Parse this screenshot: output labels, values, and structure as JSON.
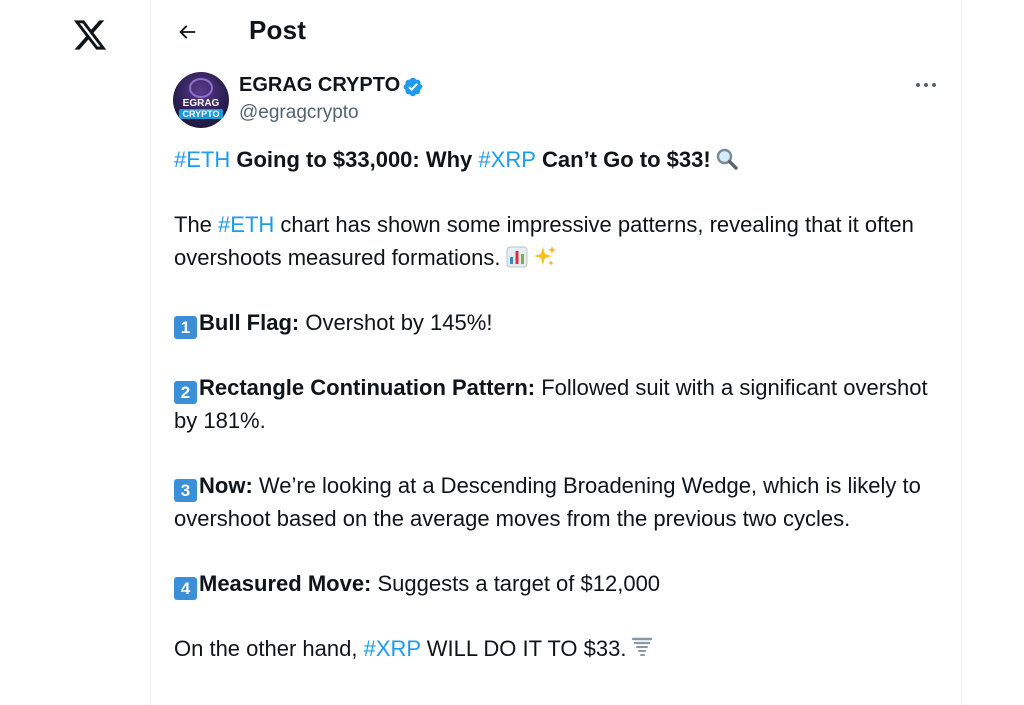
{
  "header": {
    "title": "Post"
  },
  "author": {
    "name": "EGRAG CRYPTO",
    "handle": "@egragcrypto",
    "avatar_line1": "EGRAG",
    "avatar_line2": "CRYPTO"
  },
  "tweet": {
    "line1": {
      "tag1": "#ETH",
      "text1": " Going to $33,000: Why ",
      "tag2": "#XRP",
      "text2": " Can’t Go to $33!"
    },
    "para2": {
      "text1": "The ",
      "tag": "#ETH",
      "text2": " chart has shown some impressive patterns, revealing that it often overshoots measured formations."
    },
    "item1": {
      "num": "1",
      "title": "Bull Flag:",
      "text": " Overshot by 145%!"
    },
    "item2": {
      "num": "2",
      "title": "Rectangle Continuation Pattern:",
      "text": " Followed suit with a significant overshot by 181%."
    },
    "item3": {
      "num": "3",
      "title": "Now:",
      "text": " We’re looking at a Descending Broadening Wedge, which is likely to overshoot based on the average moves from the previous two cycles."
    },
    "item4": {
      "num": "4",
      "title": "Measured Move:",
      "text": " Suggests a target of $12,000"
    },
    "last": {
      "text1": "On the other hand, ",
      "tag": "#XRP",
      "text2": " WILL DO IT TO $33."
    }
  },
  "icons": {
    "logo": "x-logo-icon",
    "back": "arrow-left-icon",
    "verified": "verified-badge-icon",
    "more": "ellipsis-icon",
    "emoji_search": "magnifying-glass-emoji",
    "emoji_chart": "bar-chart-emoji",
    "emoji_sparkles": "sparkles-emoji",
    "emoji_tornado": "tornado-emoji"
  },
  "colors": {
    "link": "#1d9bf0",
    "text": "#0f1419",
    "muted": "#536471",
    "keycap": "#3b8fd9"
  }
}
